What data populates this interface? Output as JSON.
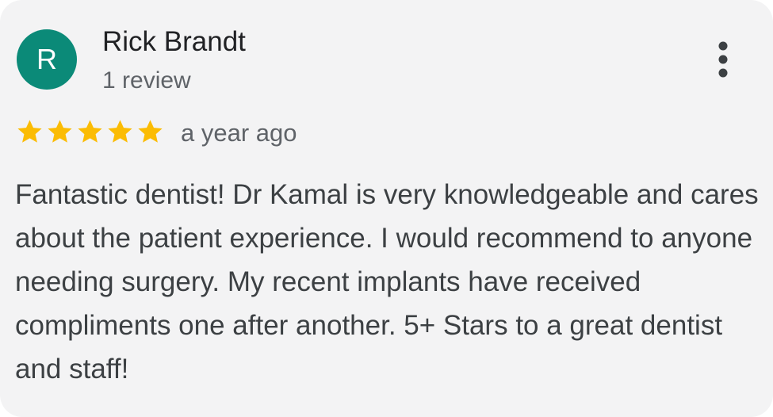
{
  "review": {
    "author": {
      "initial": "R",
      "name": "Rick Brandt",
      "review_count": "1 review",
      "avatar_color": "#0b8a78"
    },
    "rating": 5,
    "max_rating": 5,
    "star_color": "#fbbc04",
    "date": "a year ago",
    "text": "Fantastic dentist! Dr Kamal is very knowledgeable and cares about the patient experience. I would recommend to anyone needing surgery. My recent implants have received compliments one after another. 5+ Stars to a great dentist and staff!",
    "menu_icon": "more-vertical-icon"
  }
}
